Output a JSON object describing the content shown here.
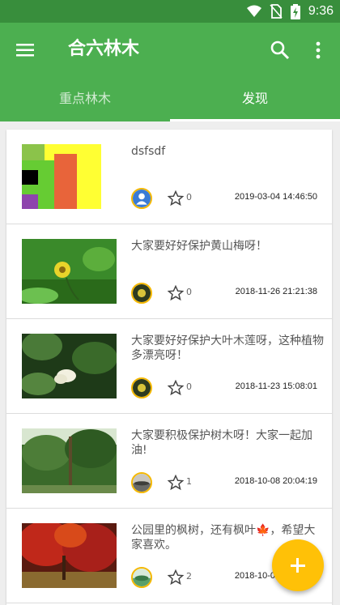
{
  "status_bar": {
    "time": "9:36"
  },
  "app_bar": {
    "title": "合六林木"
  },
  "tabs": [
    {
      "label": "重点林木",
      "active": false
    },
    {
      "label": "发现",
      "active": true
    }
  ],
  "posts": [
    {
      "text": "dsfsdf",
      "likes": "0",
      "date": "2019-03-04 14:46:50"
    },
    {
      "text": "大家要好好保护黄山梅呀！",
      "likes": "0",
      "date": "2018-11-26 21:21:38"
    },
    {
      "text": "大家要好好保护大叶木莲呀，这种植物多漂亮呀！",
      "likes": "0",
      "date": "2018-11-23 15:08:01"
    },
    {
      "text": "大家要积极保护树木呀！大家一起加油!",
      "likes": "1",
      "date": "2018-10-08 20:04:19"
    },
    {
      "text": "公园里的枫树，还有枫叶🍁，希望大家喜欢。",
      "likes": "2",
      "date": "2018-10-08 20:04:19"
    }
  ],
  "colors": {
    "primary": "#4caf50",
    "status_bar": "#388e3c",
    "fab": "#ffc107"
  }
}
